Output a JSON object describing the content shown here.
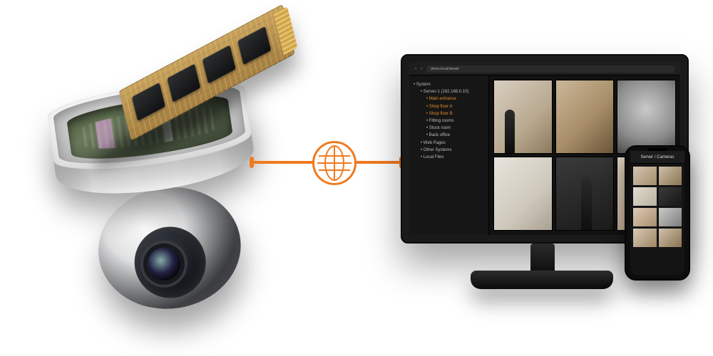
{
  "connector": {
    "icon": "globe-icon",
    "color": "#f07a1f"
  },
  "camera_device": {
    "component": "dome-security-camera",
    "module": "m2-ssd-module"
  },
  "monitor": {
    "topbar": {
      "back_icon": "chevron-left-icon",
      "fwd_icon": "chevron-right-icon",
      "url_text": "demo.local/viewer"
    },
    "tree": {
      "items": [
        {
          "label": "System",
          "cls": ""
        },
        {
          "label": "Server-1 (192.168.0.10)",
          "cls": "ind"
        },
        {
          "label": "Main entrance",
          "cls": "ind2 h"
        },
        {
          "label": "Shop floor A",
          "cls": "ind2 h"
        },
        {
          "label": "Shop floor B",
          "cls": "ind2 h"
        },
        {
          "label": "Fitting rooms",
          "cls": "ind2"
        },
        {
          "label": "Stock room",
          "cls": "ind2"
        },
        {
          "label": "Back office",
          "cls": "ind2"
        },
        {
          "label": "Web Pages",
          "cls": "ind"
        },
        {
          "label": "Other Systems",
          "cls": "ind"
        },
        {
          "label": "Local Files",
          "cls": "ind"
        }
      ]
    },
    "tiles": [
      {
        "name": "feed-1"
      },
      {
        "name": "feed-2"
      },
      {
        "name": "feed-3"
      },
      {
        "name": "feed-4"
      },
      {
        "name": "feed-5"
      },
      {
        "name": "feed-6"
      }
    ]
  },
  "phone": {
    "header": "Server / Cameras",
    "thumbs": [
      {
        "name": "p-feed-1"
      },
      {
        "name": "p-feed-2"
      },
      {
        "name": "p-feed-3"
      },
      {
        "name": "p-feed-4"
      },
      {
        "name": "p-feed-5"
      },
      {
        "name": "p-feed-6"
      },
      {
        "name": "p-feed-7"
      },
      {
        "name": "p-feed-8"
      }
    ]
  }
}
